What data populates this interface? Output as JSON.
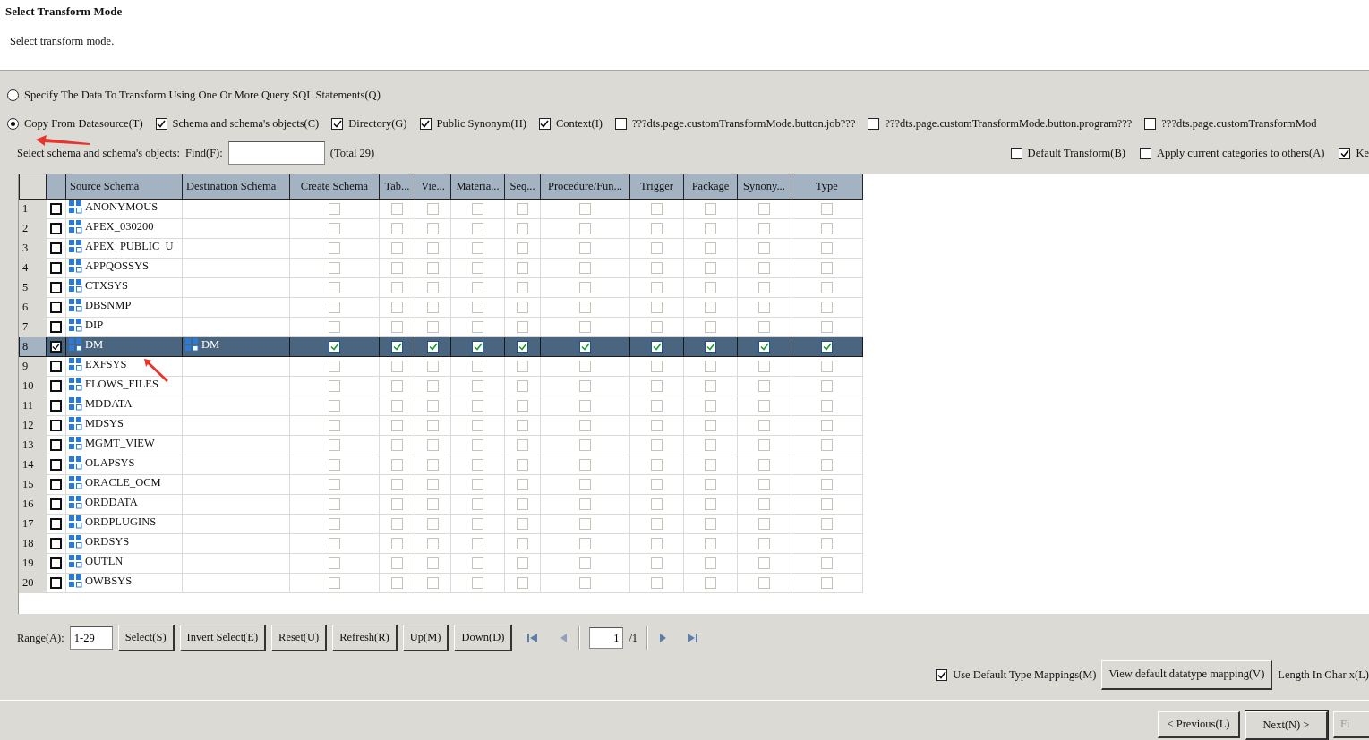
{
  "header": {
    "title": "Select Transform Mode",
    "subtitle": "Select transform mode."
  },
  "mode_options": [
    {
      "label": "Specify The Data To Transform Using One Or More Query SQL Statements(Q)",
      "selected": false
    },
    {
      "label": "Copy From Datasource(T)",
      "selected": true
    }
  ],
  "object_types": [
    {
      "label": "Schema and schema's objects(C)",
      "checked": true
    },
    {
      "label": "Directory(G)",
      "checked": true
    },
    {
      "label": "Public Synonym(H)",
      "checked": true
    },
    {
      "label": "Context(I)",
      "checked": true
    },
    {
      "label": "???dts.page.customTransformMode.button.job???",
      "checked": false
    },
    {
      "label": "???dts.page.customTransformMode.button.program???",
      "checked": false
    },
    {
      "label": "???dts.page.customTransformMod",
      "checked": false
    }
  ],
  "find": {
    "label": "Select schema and schema's objects:",
    "find_label": "Find(F):",
    "total": "(Total 29)"
  },
  "options": [
    {
      "label": "Default Transform(B)",
      "checked": false
    },
    {
      "label": "Apply current categories to others(A)",
      "checked": false
    },
    {
      "label": "Ke",
      "checked": true
    }
  ],
  "table": {
    "columns": [
      "Source Schema",
      "Destination Schema",
      "Create Schema",
      "Tab...",
      "Vie...",
      "Materia...",
      "Seq...",
      "Procedure/Fun...",
      "Trigger",
      "Package",
      "Synony...",
      "Type"
    ],
    "rows": [
      {
        "number": "1",
        "source": "ANONYMOUS",
        "checked": false,
        "selected": false,
        "cells": [
          false,
          false,
          false,
          false,
          false,
          false,
          false,
          false,
          false,
          false
        ]
      },
      {
        "number": "2",
        "source": "APEX_030200",
        "checked": false,
        "selected": false,
        "cells": [
          false,
          false,
          false,
          false,
          false,
          false,
          false,
          false,
          false,
          false
        ]
      },
      {
        "number": "3",
        "source": "APEX_PUBLIC_U",
        "checked": false,
        "selected": false,
        "cells": [
          false,
          false,
          false,
          false,
          false,
          false,
          false,
          false,
          false,
          false
        ]
      },
      {
        "number": "4",
        "source": "APPQOSSYS",
        "checked": false,
        "selected": false,
        "cells": [
          false,
          false,
          false,
          false,
          false,
          false,
          false,
          false,
          false,
          false
        ]
      },
      {
        "number": "5",
        "source": "CTXSYS",
        "checked": false,
        "selected": false,
        "cells": [
          false,
          false,
          false,
          false,
          false,
          false,
          false,
          false,
          false,
          false
        ]
      },
      {
        "number": "6",
        "source": "DBSNMP",
        "checked": false,
        "selected": false,
        "cells": [
          false,
          false,
          false,
          false,
          false,
          false,
          false,
          false,
          false,
          false
        ]
      },
      {
        "number": "7",
        "source": "DIP",
        "checked": false,
        "selected": false,
        "cells": [
          false,
          false,
          false,
          false,
          false,
          false,
          false,
          false,
          false,
          false
        ]
      },
      {
        "number": "8",
        "source": "DM",
        "destination": "DM",
        "checked": true,
        "selected": true,
        "cells": [
          true,
          true,
          true,
          true,
          true,
          true,
          true,
          true,
          true,
          true
        ]
      },
      {
        "number": "9",
        "source": "EXFSYS",
        "checked": false,
        "selected": false,
        "cells": [
          false,
          false,
          false,
          false,
          false,
          false,
          false,
          false,
          false,
          false
        ]
      },
      {
        "number": "10",
        "source": "FLOWS_FILES",
        "checked": false,
        "selected": false,
        "cells": [
          false,
          false,
          false,
          false,
          false,
          false,
          false,
          false,
          false,
          false
        ]
      },
      {
        "number": "11",
        "source": "MDDATA",
        "checked": false,
        "selected": false,
        "cells": [
          false,
          false,
          false,
          false,
          false,
          false,
          false,
          false,
          false,
          false
        ]
      },
      {
        "number": "12",
        "source": "MDSYS",
        "checked": false,
        "selected": false,
        "cells": [
          false,
          false,
          false,
          false,
          false,
          false,
          false,
          false,
          false,
          false
        ]
      },
      {
        "number": "13",
        "source": "MGMT_VIEW",
        "checked": false,
        "selected": false,
        "cells": [
          false,
          false,
          false,
          false,
          false,
          false,
          false,
          false,
          false,
          false
        ]
      },
      {
        "number": "14",
        "source": "OLAPSYS",
        "checked": false,
        "selected": false,
        "cells": [
          false,
          false,
          false,
          false,
          false,
          false,
          false,
          false,
          false,
          false
        ]
      },
      {
        "number": "15",
        "source": "ORACLE_OCM",
        "checked": false,
        "selected": false,
        "cells": [
          false,
          false,
          false,
          false,
          false,
          false,
          false,
          false,
          false,
          false
        ]
      },
      {
        "number": "16",
        "source": "ORDDATA",
        "checked": false,
        "selected": false,
        "cells": [
          false,
          false,
          false,
          false,
          false,
          false,
          false,
          false,
          false,
          false
        ]
      },
      {
        "number": "17",
        "source": "ORDPLUGINS",
        "checked": false,
        "selected": false,
        "cells": [
          false,
          false,
          false,
          false,
          false,
          false,
          false,
          false,
          false,
          false
        ]
      },
      {
        "number": "18",
        "source": "ORDSYS",
        "checked": false,
        "selected": false,
        "cells": [
          false,
          false,
          false,
          false,
          false,
          false,
          false,
          false,
          false,
          false
        ]
      },
      {
        "number": "19",
        "source": "OUTLN",
        "checked": false,
        "selected": false,
        "cells": [
          false,
          false,
          false,
          false,
          false,
          false,
          false,
          false,
          false,
          false
        ]
      },
      {
        "number": "20",
        "source": "OWBSYS",
        "checked": false,
        "selected": false,
        "cells": [
          false,
          false,
          false,
          false,
          false,
          false,
          false,
          false,
          false,
          false
        ]
      }
    ]
  },
  "toolbar": {
    "range_label": "Range(A):",
    "range_value": "1-29",
    "buttons": [
      "Select(S)",
      "Invert Select(E)",
      "Reset(U)",
      "Refresh(R)",
      "Up(M)",
      "Down(D)"
    ],
    "page": "1",
    "page_total": "/1"
  },
  "mapping": {
    "label": "Use Default Type Mappings(M)",
    "checked": true,
    "button": "View default datatype mapping(V)",
    "length_label": "Length In Char x(L)"
  },
  "nav_buttons": [
    {
      "label": "< Previous(L)",
      "default": false,
      "disabled": false
    },
    {
      "label": "Next(N) >",
      "default": true,
      "disabled": false
    },
    {
      "label": "Fi",
      "default": false,
      "disabled": true
    }
  ]
}
